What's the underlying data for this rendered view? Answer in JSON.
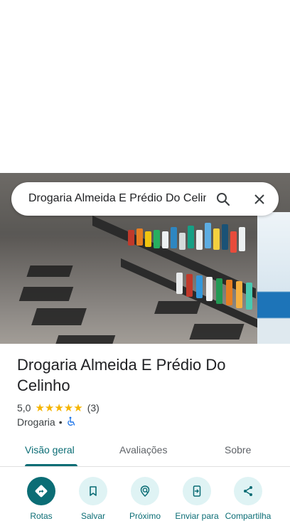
{
  "search": {
    "query": "Drogaria Almeida E Prédio Do Celinho"
  },
  "place": {
    "name": "Drogaria Almeida E Prédio Do Celinho",
    "rating": "5,0",
    "stars": "★★★★★",
    "review_count": "(3)",
    "category": "Drogaria",
    "separator": "•"
  },
  "tabs": [
    {
      "label": "Visão geral",
      "active": true
    },
    {
      "label": "Avaliações",
      "active": false
    },
    {
      "label": "Sobre",
      "active": false
    }
  ],
  "actions": [
    {
      "label": "Rotas",
      "icon": "directions-icon"
    },
    {
      "label": "Salvar",
      "icon": "bookmark-icon"
    },
    {
      "label": "Próximo",
      "icon": "nearby-icon"
    },
    {
      "label": "Enviar para",
      "icon": "send-to-phone-icon"
    },
    {
      "label": "Compartilha",
      "icon": "share-icon"
    }
  ],
  "colors": {
    "accent": "#0b6d75",
    "accent_light": "#dff3f4",
    "star": "#f5b400"
  }
}
